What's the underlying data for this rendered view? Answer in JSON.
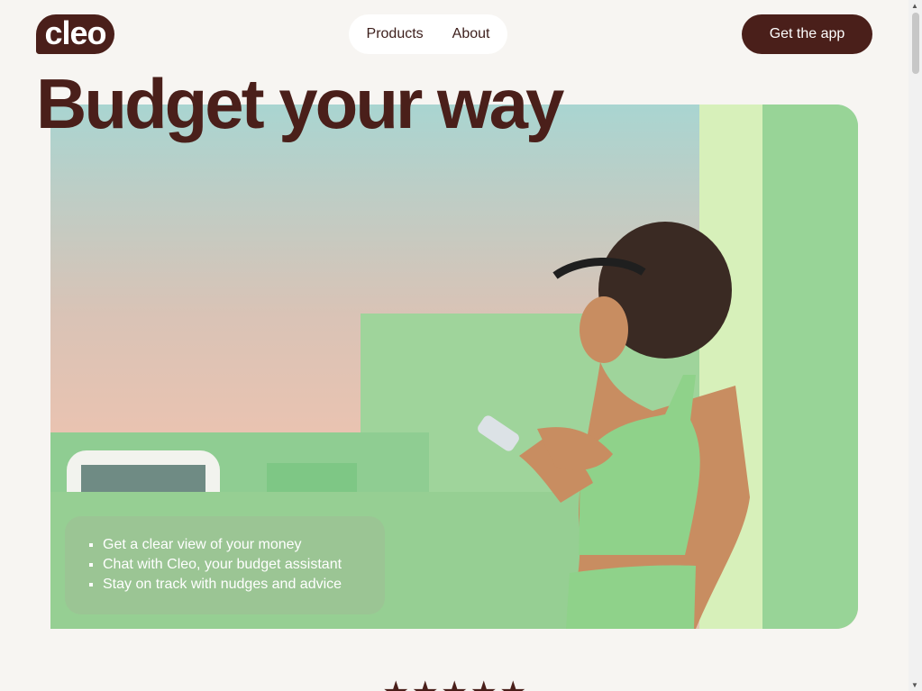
{
  "header": {
    "logo_text": "cleo",
    "nav": [
      {
        "label": "Products"
      },
      {
        "label": "About"
      }
    ],
    "cta_label": "Get the app"
  },
  "hero": {
    "title": "Budget your way",
    "bullets": [
      "Get a clear view of your money",
      "Chat with Cleo, your budget assistant",
      "Stay on track with nudges and advice"
    ]
  },
  "rating": {
    "stars": 5
  },
  "icons": [
    "chevron-up-icon",
    "chevron-down-icon",
    "star-icon"
  ],
  "colors": {
    "brand": "#4a1f1a",
    "background": "#f7f5f2",
    "hero_green": "#9fd49b"
  }
}
